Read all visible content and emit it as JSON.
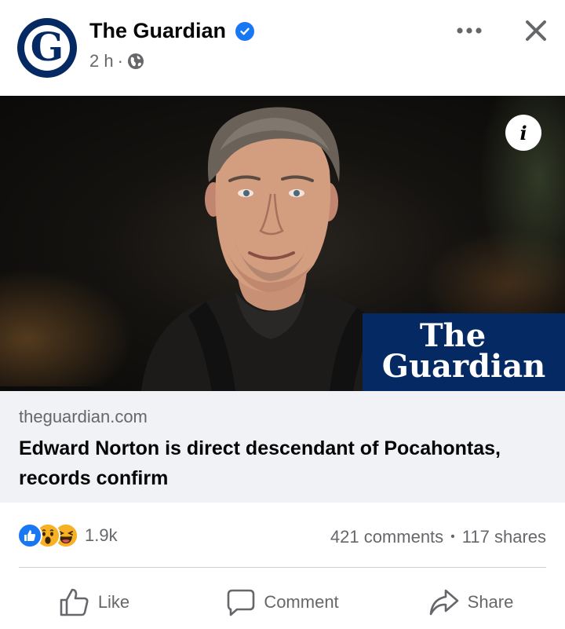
{
  "post": {
    "page_name": "The Guardian",
    "avatar_letter": "G",
    "time": "2 h",
    "dot": "·",
    "privacy_icon": "globe-icon",
    "more_icon": "more-horizontal-icon",
    "close_icon": "close-icon",
    "verified_icon": "verified-badge-icon"
  },
  "media": {
    "info_label": "i",
    "logo_line1": "The",
    "logo_line2": "Guardian",
    "logo_color": "#052962"
  },
  "link_preview": {
    "domain": "theguardian.com",
    "title": "Edward Norton is direct descendant of Pocahontas, records confirm"
  },
  "stats": {
    "reaction_icons": [
      "like-reaction-icon",
      "wow-reaction-icon",
      "haha-reaction-icon"
    ],
    "reaction_count": "1.9k",
    "comments": "421 comments",
    "separator": "•",
    "shares": "117 shares"
  },
  "actions": {
    "like": "Like",
    "comment": "Comment",
    "share": "Share"
  },
  "colors": {
    "accent": "#1877f2",
    "muted_text": "#65676b",
    "link_bg": "#f0f2f5",
    "reaction_yellow": "#f7b125"
  }
}
